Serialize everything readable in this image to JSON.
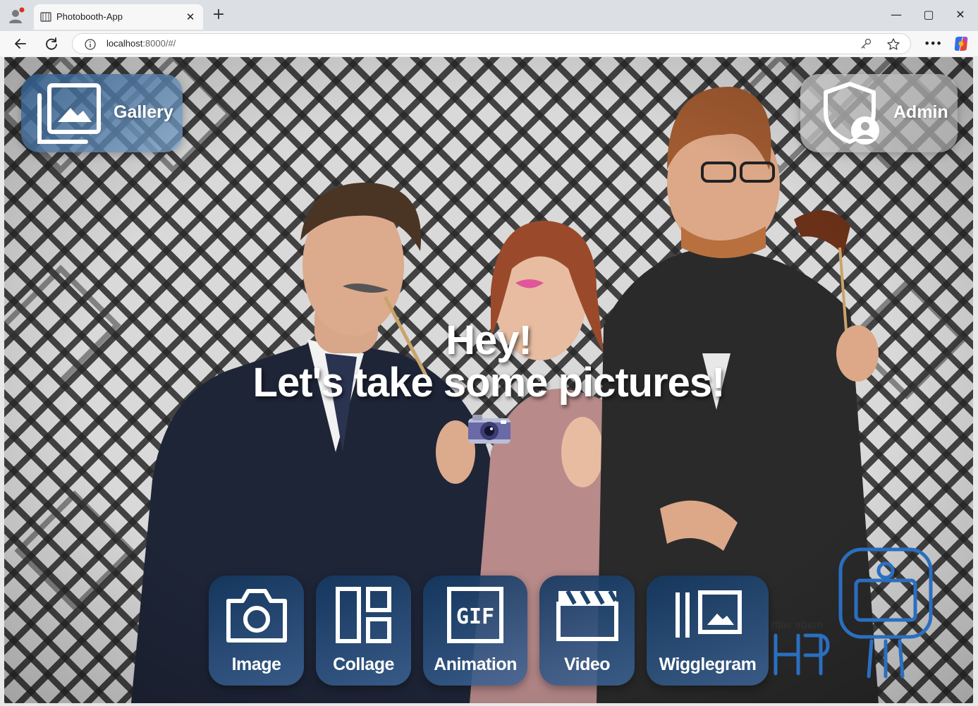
{
  "browser": {
    "tab_title": "Photobooth-App",
    "tab_close": "✕",
    "new_tab": "+",
    "url_host": "localhost",
    "url_rest": ":8000/#/",
    "minimize": "—",
    "maximize": "▢",
    "close": "✕",
    "more": "•••"
  },
  "app": {
    "gallery_label": "Gallery",
    "admin_label": "Admin",
    "hero_line1": "Hey!",
    "hero_line2": "Let's take some pictures!",
    "actions": [
      {
        "label": "Image",
        "icon": "camera-icon"
      },
      {
        "label": "Collage",
        "icon": "collage-icon"
      },
      {
        "label": "Animation",
        "icon": "gif-icon"
      },
      {
        "label": "Video",
        "icon": "clapperboard-icon"
      },
      {
        "label": "Wigglegram",
        "icon": "wigglegram-icon"
      }
    ],
    "brand_text": "made with",
    "brand_logo_letters": "PH"
  },
  "colors": {
    "action_bg": "#1d4470",
    "accent_blue": "#2a6fc0",
    "text": "#ffffff"
  }
}
